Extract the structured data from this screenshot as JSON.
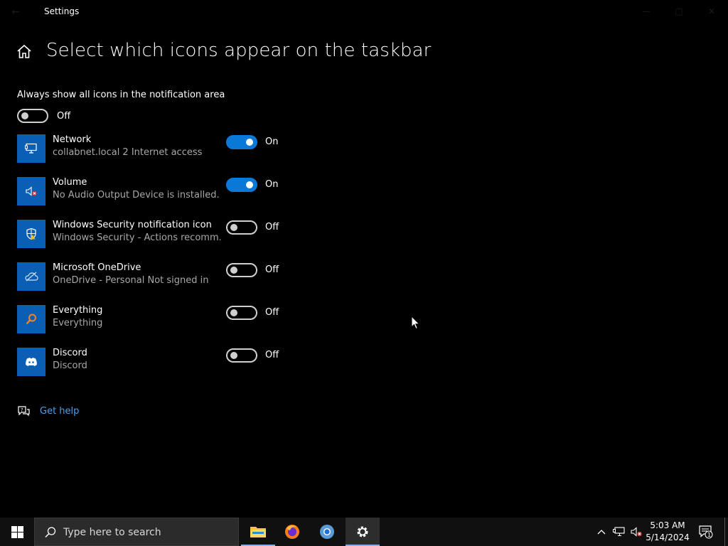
{
  "window": {
    "app_title": "Settings"
  },
  "header": {
    "page_title": "Select which icons appear on the taskbar"
  },
  "master": {
    "label": "Always show all icons in the notification area",
    "state": "Off"
  },
  "apps": [
    {
      "name": "Network",
      "description": "collabnet.local 2 Internet access",
      "state": "On",
      "icon": "network-icon"
    },
    {
      "name": "Volume",
      "description": "No Audio Output Device is installed.",
      "state": "On",
      "icon": "volume-muted-icon"
    },
    {
      "name": "Windows Security notification icon",
      "description": "Windows Security - Actions recomm...",
      "state": "Off",
      "icon": "shield-icon"
    },
    {
      "name": "Microsoft OneDrive",
      "description": "OneDrive - Personal Not signed in",
      "state": "Off",
      "icon": "onedrive-cloud-icon"
    },
    {
      "name": "Everything",
      "description": "Everything",
      "state": "Off",
      "icon": "magnifier-icon"
    },
    {
      "name": "Discord",
      "description": "Discord",
      "state": "Off",
      "icon": "discord-icon"
    }
  ],
  "help": {
    "label": "Get help"
  },
  "taskbar": {
    "search_placeholder": "Type here to search",
    "apps": [
      "file-explorer-icon",
      "firefox-icon",
      "chrome-icon",
      "settings-gear-icon"
    ],
    "clock_time": "5:03 AM",
    "clock_date": "5/14/2024",
    "notification_count": "1"
  },
  "colors": {
    "accent": "#0a78d7",
    "tile": "#0a5fb4",
    "link": "#4aa3f0",
    "background": "#000000"
  }
}
